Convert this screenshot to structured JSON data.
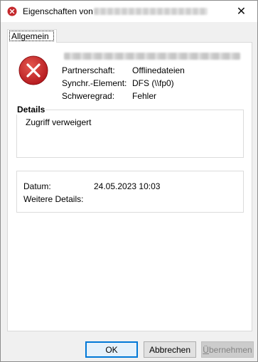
{
  "window": {
    "title": "Eigenschaften von",
    "close_glyph": "✕"
  },
  "tabs": [
    {
      "label": "Allgemein"
    }
  ],
  "item": {
    "rows": [
      {
        "label": "Partnerschaft:",
        "value": "Offlinedateien"
      },
      {
        "label": "Synchr.-Element:",
        "value": "DFS (\\\\fp0)"
      },
      {
        "label": "Schweregrad:",
        "value": "Fehler"
      }
    ]
  },
  "details": {
    "legend": "Details",
    "text": "Zugriff verweigert"
  },
  "meta": {
    "date_label": "Datum:",
    "date_value": "24.05.2023 10:03",
    "more_label": "Weitere Details:"
  },
  "buttons": {
    "ok": "OK",
    "cancel": "Abbrechen",
    "apply_mnemonic": "Ü",
    "apply_rest": "bernehmen"
  },
  "colors": {
    "error_red": "#c4282c",
    "accent_blue": "#0078d7"
  },
  "icons": [
    "error-icon",
    "close-icon"
  ]
}
